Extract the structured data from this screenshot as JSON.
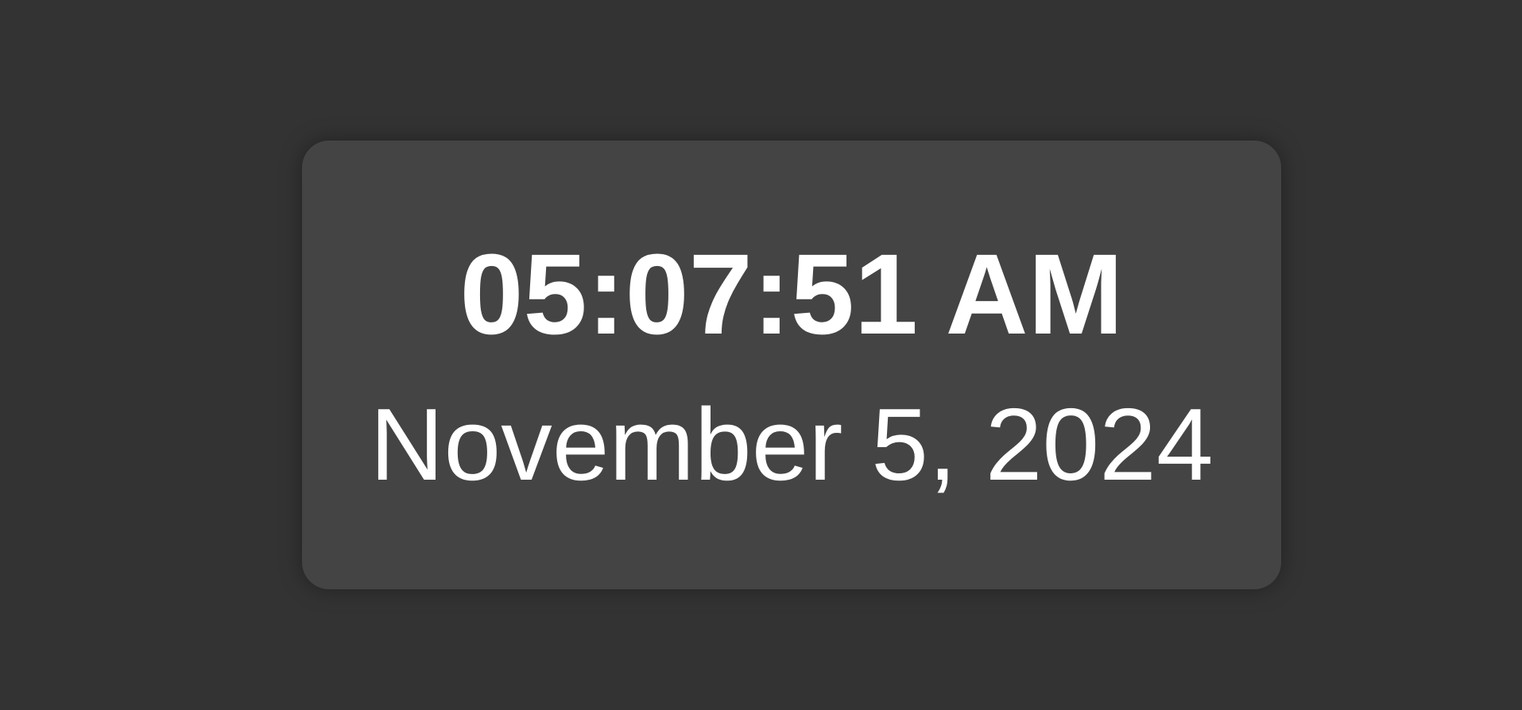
{
  "clock": {
    "time": "05:07:51 AM",
    "date": "November 5, 2024"
  },
  "colors": {
    "page_background": "#333333",
    "card_background": "#444444",
    "text": "#ffffff"
  }
}
